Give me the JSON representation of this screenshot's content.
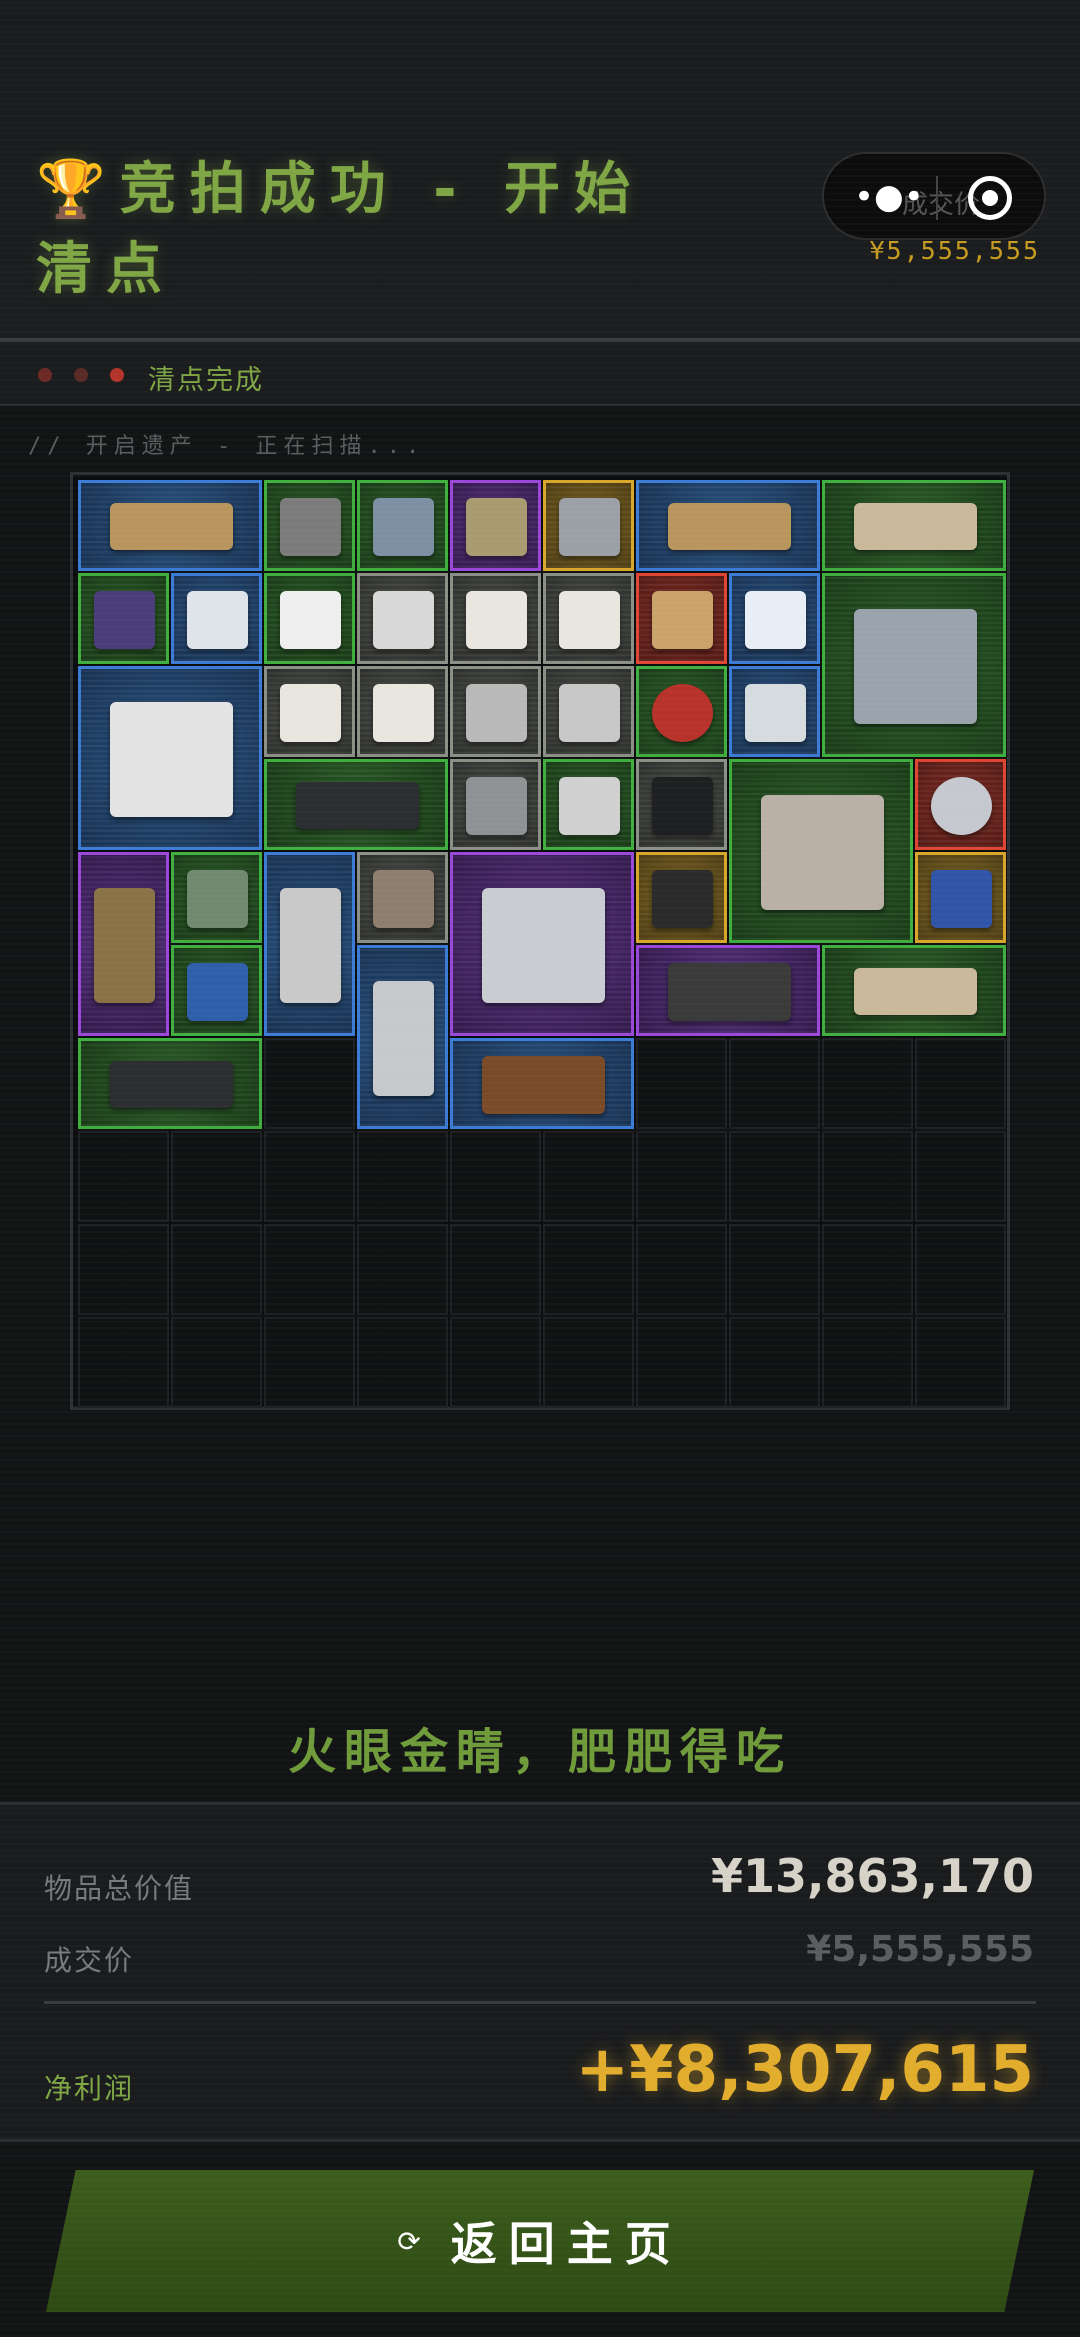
{
  "header": {
    "title": "竞拍成功 - 开始清点",
    "trophy_icon": "🏆",
    "capsule_label": "成交价",
    "deal_price_small": "¥5,555,555"
  },
  "status": {
    "label": "清点完成",
    "dot_colors": [
      "#6d2a24",
      "#5a2a25",
      "#b3342b"
    ]
  },
  "scan_text": "// 开启遗产 - 正在扫描...",
  "grid": {
    "columns": 10,
    "rows": 10,
    "items": [
      {
        "name": "wooden-plank",
        "rarity": "blue"
      },
      {
        "name": "zippo-lighter",
        "rarity": "green"
      },
      {
        "name": "pliers",
        "rarity": "green"
      },
      {
        "name": "tin-can",
        "rarity": "purple"
      },
      {
        "name": "drill-tool",
        "rarity": "gold"
      },
      {
        "name": "wooden-plank",
        "rarity": "blue"
      },
      {
        "name": "old-paper",
        "rarity": "green"
      },
      {
        "name": "medicine-vial",
        "rarity": "green"
      },
      {
        "name": "thermometer-gun",
        "rarity": "blue"
      },
      {
        "name": "glue-bottle",
        "rarity": "green"
      },
      {
        "name": "yogurt-cup",
        "rarity": "gray"
      },
      {
        "name": "playing-card",
        "rarity": "gray"
      },
      {
        "name": "playing-card",
        "rarity": "gray"
      },
      {
        "name": "motor-part",
        "rarity": "red"
      },
      {
        "name": "pill-bottle",
        "rarity": "blue"
      },
      {
        "name": "power-supply",
        "rarity": "green"
      },
      {
        "name": "label-printer",
        "rarity": "blue"
      },
      {
        "name": "playing-card",
        "rarity": "gray"
      },
      {
        "name": "playing-card",
        "rarity": "gray"
      },
      {
        "name": "scissors",
        "rarity": "gray"
      },
      {
        "name": "foil-pack",
        "rarity": "gray"
      },
      {
        "name": "apple",
        "rarity": "green"
      },
      {
        "name": "watch-band",
        "rarity": "blue"
      },
      {
        "name": "keyboard",
        "rarity": "green"
      },
      {
        "name": "computer-mouse",
        "rarity": "gray"
      },
      {
        "name": "tube",
        "rarity": "green"
      },
      {
        "name": "protein-jar",
        "rarity": "gray"
      },
      {
        "name": "magazine",
        "rarity": "green"
      },
      {
        "name": "crystal-shard",
        "rarity": "red"
      },
      {
        "name": "map-bag",
        "rarity": "purple"
      },
      {
        "name": "circuit-board",
        "rarity": "green"
      },
      {
        "name": "ammo-box",
        "rarity": "blue"
      },
      {
        "name": "lipstick",
        "rarity": "gray"
      },
      {
        "name": "lab-incubator",
        "rarity": "purple"
      },
      {
        "name": "camera",
        "rarity": "gold"
      },
      {
        "name": "smartphone",
        "rarity": "gold"
      },
      {
        "name": "battery",
        "rarity": "green"
      },
      {
        "name": "statue",
        "rarity": "blue"
      },
      {
        "name": "whetstone",
        "rarity": "purple"
      },
      {
        "name": "old-paper",
        "rarity": "green"
      },
      {
        "name": "keyboard",
        "rarity": "green"
      },
      {
        "name": "tobacco-pipe",
        "rarity": "blue"
      }
    ]
  },
  "slogan": "火眼金睛，肥肥得吃",
  "summary": {
    "total_label": "物品总价值",
    "total_value": "¥13,863,170",
    "deal_label": "成交价",
    "deal_value": "¥5,555,555",
    "profit_label": "净利润",
    "profit_value": "+¥8,307,615"
  },
  "button": {
    "icon": "⟳",
    "label": "返回主页"
  },
  "colors": {
    "accent_green": "#7fa644",
    "gold": "#e2ad2c",
    "rarity_blue": "#3b7bd6",
    "rarity_green": "#3fae3f",
    "rarity_purple": "#9a46d8",
    "rarity_gold": "#d7a62a",
    "rarity_red": "#df4533",
    "rarity_gray": "#8c8f86"
  }
}
